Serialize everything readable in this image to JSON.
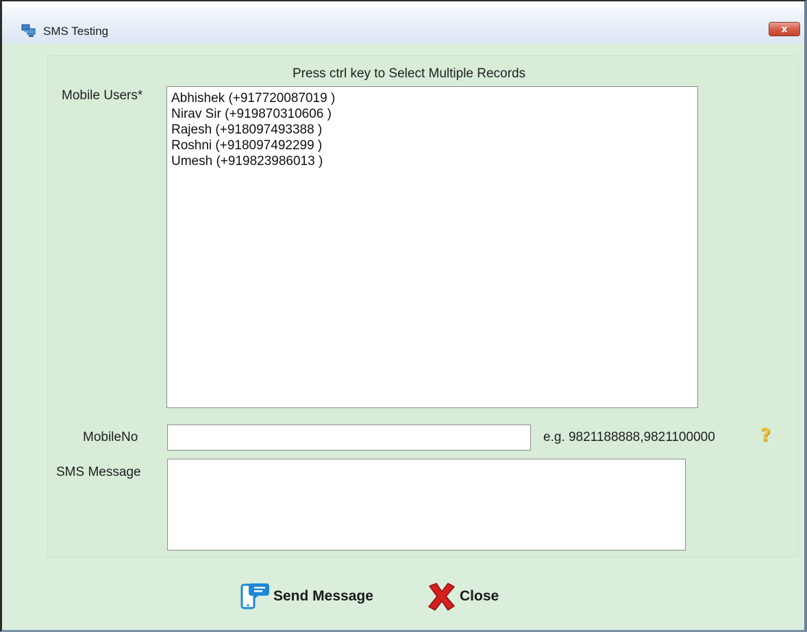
{
  "window": {
    "title": "SMS Testing",
    "close_symbol": "x"
  },
  "form": {
    "hint": "Press ctrl key to Select Multiple Records",
    "mobile_users_label": "Mobile Users*",
    "mobile_users": [
      "Abhishek (+917720087019 )",
      "Nirav Sir (+919870310606 )",
      "Rajesh (+918097493388 )",
      "Roshni (+918097492299 )",
      "Umesh (+919823986013 )"
    ],
    "mobile_no_label": "MobileNo",
    "mobile_no_value": "",
    "mobile_no_example": "e.g. 9821188888,9821100000",
    "sms_message_label": "SMS Message",
    "sms_message_value": ""
  },
  "buttons": {
    "send_label": "Send Message",
    "close_label": "Close"
  },
  "icons": {
    "title": "computers-network-icon",
    "help": "question-mark-icon",
    "send": "phone-message-icon",
    "close": "red-x-icon"
  },
  "colors": {
    "background": "#dbeedb",
    "close_button": "#d45f47",
    "help_icon": "#e9c23a",
    "send_icon": "#1e88d6",
    "close_icon": "#d42020"
  }
}
